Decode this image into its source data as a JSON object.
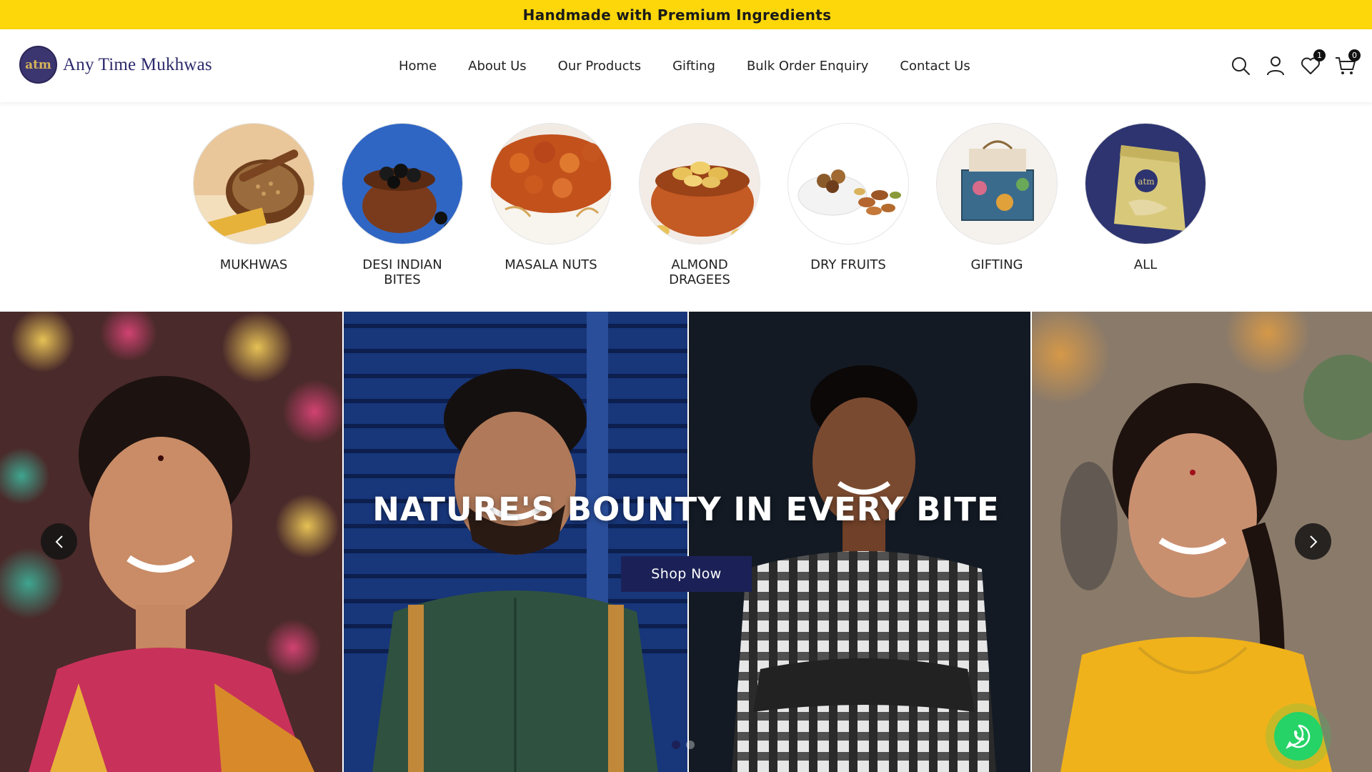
{
  "announcement": {
    "text": "Handmade with Premium Ingredients"
  },
  "brand": {
    "logo_mark": "atm",
    "name": "Any Time Mukhwas"
  },
  "nav": {
    "items": [
      {
        "label": "Home"
      },
      {
        "label": "About Us"
      },
      {
        "label": "Our Products"
      },
      {
        "label": "Gifting"
      },
      {
        "label": "Bulk Order Enquiry"
      },
      {
        "label": "Contact Us"
      }
    ]
  },
  "header_icons": {
    "search": "search-icon",
    "account": "user-icon",
    "wishlist": {
      "icon": "heart-icon",
      "count": "1"
    },
    "cart": {
      "icon": "cart-icon",
      "count": "0"
    }
  },
  "categories": [
    {
      "label": "MUKHWAS"
    },
    {
      "label": "DESI INDIAN BITES"
    },
    {
      "label": "MASALA NUTS"
    },
    {
      "label": "ALMOND DRAGEES"
    },
    {
      "label": "DRY FRUITS"
    },
    {
      "label": "GIFTING"
    },
    {
      "label": "ALL"
    }
  ],
  "hero": {
    "title": "NATURE'S BOUNTY IN EVERY BITE",
    "cta_label": "Shop Now",
    "prev_icon": "chevron-left-icon",
    "next_icon": "chevron-right-icon",
    "slide_count": 2,
    "active_slide": 1
  },
  "colors": {
    "announcement_bg": "#fdd70a",
    "brand_navy": "#1b2157",
    "logo_text": "#2d2a6b",
    "whatsapp_green": "#25d366"
  },
  "floating": {
    "whatsapp_icon": "whatsapp-icon"
  }
}
